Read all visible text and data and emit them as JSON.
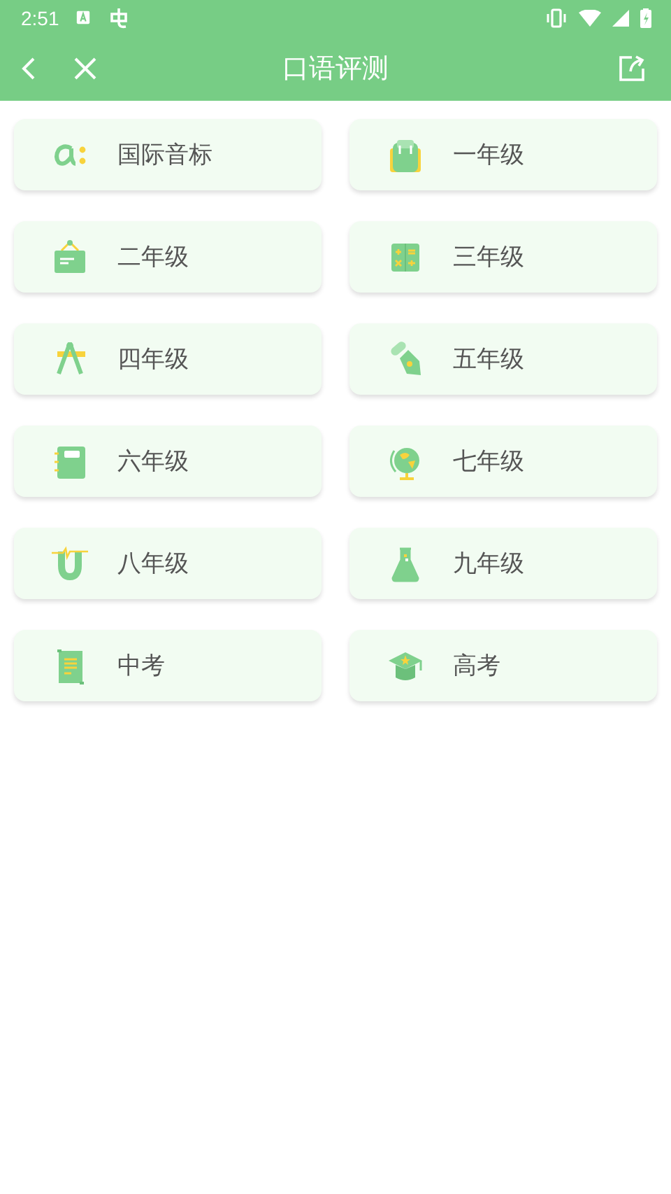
{
  "status_bar": {
    "time": "2:51"
  },
  "header": {
    "title": "口语评测"
  },
  "items": [
    {
      "label": "国际音标",
      "kind": "alpha"
    },
    {
      "label": "一年级",
      "kind": "backpack"
    },
    {
      "label": "二年级",
      "kind": "board"
    },
    {
      "label": "三年级",
      "kind": "calculator"
    },
    {
      "label": "四年级",
      "kind": "compass"
    },
    {
      "label": "五年级",
      "kind": "pen"
    },
    {
      "label": "六年级",
      "kind": "notebook"
    },
    {
      "label": "七年级",
      "kind": "globe"
    },
    {
      "label": "八年级",
      "kind": "magnet"
    },
    {
      "label": "九年级",
      "kind": "flask"
    },
    {
      "label": "中考",
      "kind": "scroll"
    },
    {
      "label": "高考",
      "kind": "cap"
    }
  ]
}
